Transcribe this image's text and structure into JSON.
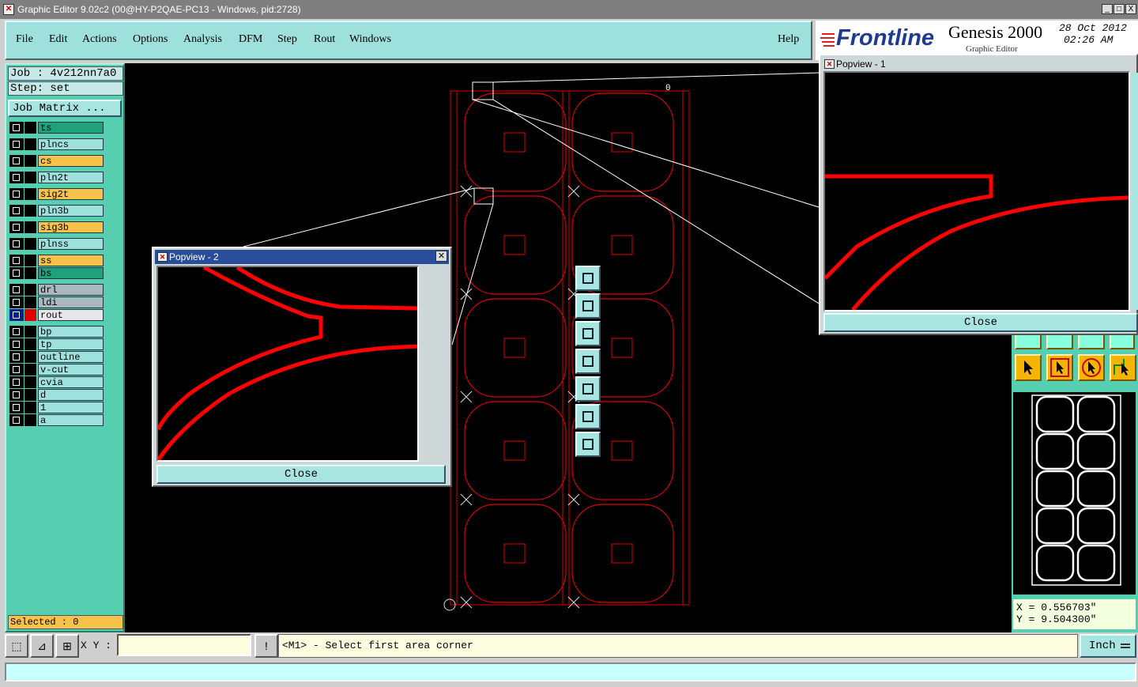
{
  "window": {
    "title": "Graphic Editor 9.02c2 (00@HY-P2QAE-PC13 - Windows, pid:2728)",
    "controls": [
      "_",
      "□",
      "X"
    ]
  },
  "menu": {
    "items": [
      "File",
      "Edit",
      "Actions",
      "Options",
      "Analysis",
      "DFM",
      "Step",
      "Rout",
      "Windows"
    ],
    "help": "Help"
  },
  "brand": {
    "logo": "Frontline",
    "product": "Genesis 2000",
    "subtitle": "Graphic Editor",
    "date": "28 Oct 2012",
    "time": "02:26 AM"
  },
  "job": {
    "job_label": "Job  : 4v212nn7a0",
    "step_label": "Step: set",
    "job_matrix": "Job Matrix ..."
  },
  "layers": [
    {
      "name": "ts",
      "bg": "#1fa27a"
    },
    {
      "name": "plncs",
      "bg": "#9ee0dc"
    },
    {
      "name": "cs",
      "bg": "#f7c24a"
    },
    {
      "name": "pln2t",
      "bg": "#9ee0dc"
    },
    {
      "name": "sig2t",
      "bg": "#f7c24a"
    },
    {
      "name": "pln3b",
      "bg": "#9ee0dc"
    },
    {
      "name": "sig3b",
      "bg": "#f7c24a"
    },
    {
      "name": "plnss",
      "bg": "#9ee0dc"
    },
    {
      "name": "ss",
      "bg": "#f7c24a"
    },
    {
      "name": "bs",
      "bg": "#1fa27a"
    },
    {
      "name": "drl",
      "bg": "#a8b8bc"
    },
    {
      "name": "ldi",
      "bg": "#a8b8bc"
    },
    {
      "name": "rout",
      "bg": "#e8e8e8"
    },
    {
      "name": "bp",
      "bg": "#9ee0dc"
    },
    {
      "name": "tp",
      "bg": "#9ee0dc"
    },
    {
      "name": "outline",
      "bg": "#9ee0dc"
    },
    {
      "name": "v-cut",
      "bg": "#9ee0dc"
    },
    {
      "name": "cvia",
      "bg": "#9ee0dc"
    },
    {
      "name": "d",
      "bg": "#9ee0dc"
    },
    {
      "name": "1",
      "bg": "#9ee0dc"
    },
    {
      "name": "a",
      "bg": "#9ee0dc"
    }
  ],
  "active_layer": "rout",
  "selected": "Selected : 0",
  "canvas": {
    "origin_label": "0",
    "rout_color": "#e00000"
  },
  "popview1": {
    "title": "Popview - 1",
    "close": "Close"
  },
  "popview2": {
    "title": "Popview - 2",
    "close": "Close"
  },
  "coords": {
    "x": "X  = 0.556703\"",
    "y": "Y  = 9.504300\""
  },
  "status": {
    "xy_label": "X Y :",
    "xy_value": "",
    "prompt": "<M1> - Select first area corner",
    "unit": "Inch"
  },
  "colors": {
    "panel": "#55cfb0",
    "menu": "#9ee0dc",
    "accent": "#f5b400"
  }
}
